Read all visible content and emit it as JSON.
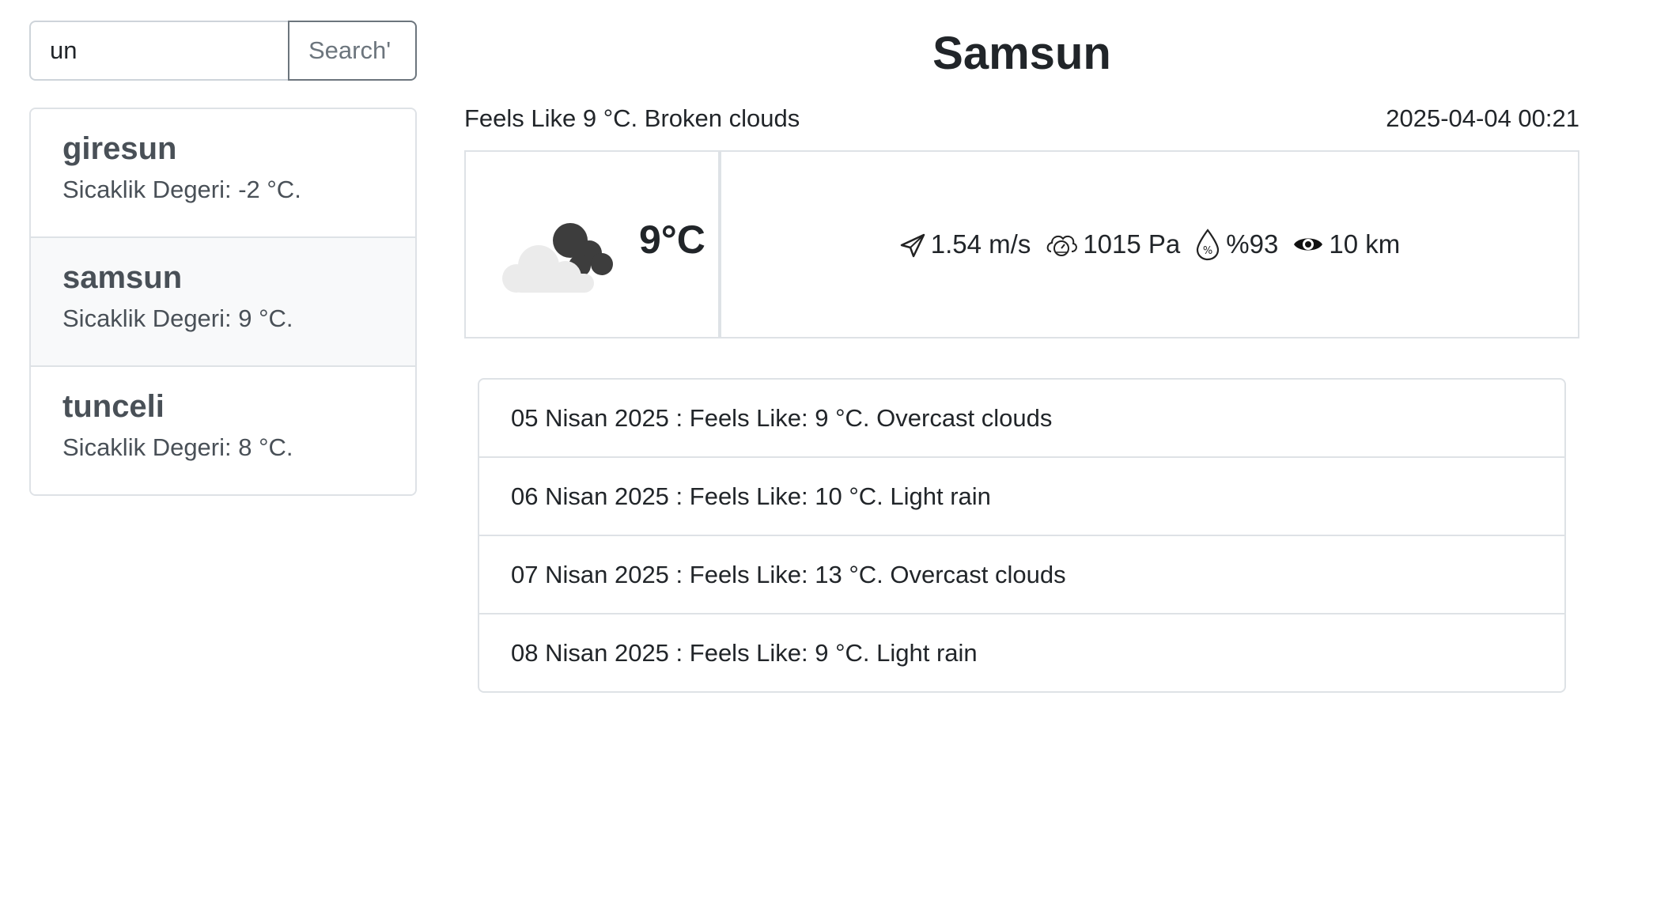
{
  "search": {
    "value": "un",
    "button_label": "Search'"
  },
  "cities": [
    {
      "name": "giresun",
      "temp": "Sicaklik Degeri: -2 °C.",
      "active": false
    },
    {
      "name": "samsun",
      "temp": "Sicaklik Degeri: 9 °C.",
      "active": true
    },
    {
      "name": "tunceli",
      "temp": "Sicaklik Degeri: 8 °C.",
      "active": false
    }
  ],
  "current": {
    "city": "Samsun",
    "description": "Feels Like 9 °C. Broken clouds",
    "datetime": "2025-04-04 00:21",
    "temperature": "9°C",
    "icon": "broken-clouds-icon",
    "wind": "1.54 m/s",
    "pressure": "1015 Pa",
    "humidity": "%93",
    "visibility": "10 km"
  },
  "forecast": [
    {
      "text": "05 Nisan 2025 : Feels Like: 9 °C. Overcast clouds"
    },
    {
      "text": "06 Nisan 2025 : Feels Like: 10 °C. Light rain"
    },
    {
      "text": "07 Nisan 2025 : Feels Like: 13 °C. Overcast clouds"
    },
    {
      "text": "08 Nisan 2025 : Feels Like: 9 °C. Light rain"
    }
  ],
  "colors": {
    "border": "#dee2e6",
    "active_item_bg": "#f8f9fa",
    "secondary": "#6c757d",
    "text": "#212529"
  }
}
